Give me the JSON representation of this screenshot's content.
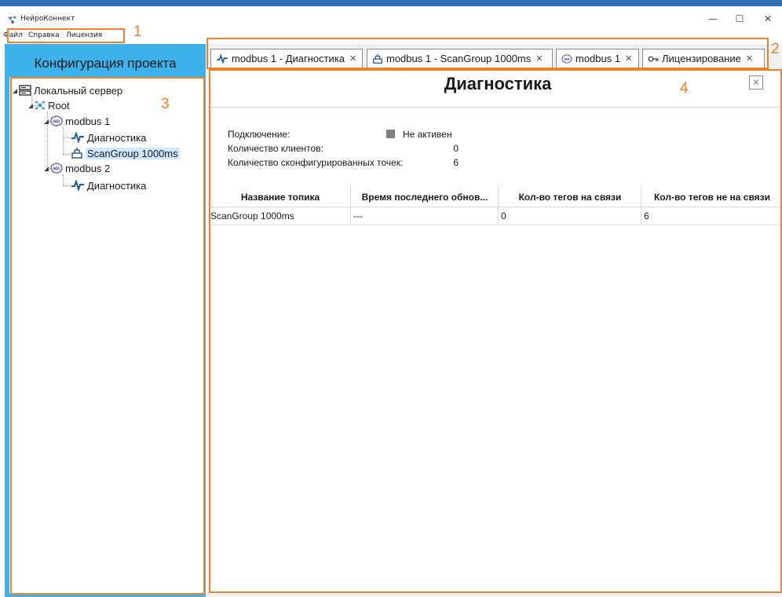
{
  "window": {
    "title": "НейроКоннект",
    "minimize": "—",
    "maximize": "☐",
    "close": "✕"
  },
  "menu": [
    "Файл",
    "Справка",
    "Лицензия"
  ],
  "annotations": [
    "1",
    "2",
    "3",
    "4"
  ],
  "panel": {
    "title": "Конфигурация проекта"
  },
  "tree": {
    "server": "Локальный сервер",
    "root": "Root",
    "modbus1": "modbus 1",
    "diag1": "Диагностика",
    "scangroup": "ScanGroup 1000ms",
    "modbus2": "modbus 2",
    "diag2": "Диагностика"
  },
  "tabs": [
    {
      "label": "modbus 1 - Диагностика",
      "close": "✕",
      "icon": "pulse-icon"
    },
    {
      "label": "modbus 1 - ScanGroup 1000ms",
      "close": "✕",
      "icon": "scangroup-icon"
    },
    {
      "label": "modbus 1",
      "close": "✕",
      "icon": "modbus-icon"
    },
    {
      "label": "Лицензирование",
      "close": "✕",
      "icon": "key-icon"
    }
  ],
  "diagnostics": {
    "title": "Диагностика",
    "close": "✕",
    "connection_label": "Подключение:",
    "connection_value": "Не активен",
    "clients_label": "Количество клиентов:",
    "clients_value": "0",
    "points_label": "Количество сконфигурированных точек:",
    "points_value": "6"
  },
  "table": {
    "headers": [
      "Название топика",
      "Время последнего обнов...",
      "Кол-во тегов на связи",
      "Кол-во тегов не на связи"
    ],
    "rows": [
      [
        "ScanGroup 1000ms",
        "---",
        "0",
        "6"
      ]
    ]
  },
  "colors": {
    "accent_panel": "#3db1ea",
    "annotation": "#f07f2a",
    "selection": "#cce8ff",
    "status_inactive": "#7f7f7f"
  }
}
